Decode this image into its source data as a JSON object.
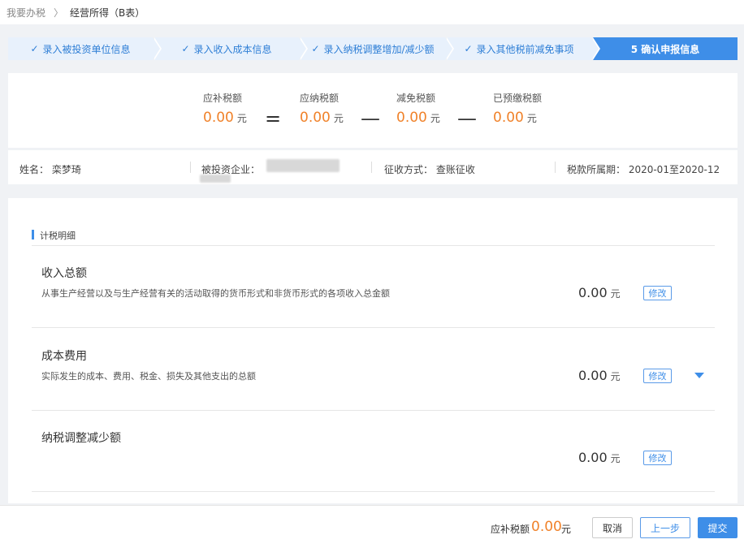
{
  "breadcrumb": {
    "home": "我要办税",
    "separator": "〉",
    "current": "经营所得（B表）"
  },
  "steps": [
    {
      "label": "录入被投资单位信息",
      "done": true
    },
    {
      "label": "录入收入成本信息",
      "done": true
    },
    {
      "label": "录入纳税调整增加/减少额",
      "done": true
    },
    {
      "label": "录入其他税前减免事项",
      "done": true
    },
    {
      "label": "5 确认申报信息",
      "done": false
    }
  ],
  "check_icon": "✓",
  "summary": {
    "items": [
      {
        "label": "应补税额",
        "value": "0.00",
        "unit": "元"
      },
      {
        "label": "应纳税额",
        "value": "0.00",
        "unit": "元"
      },
      {
        "label": "减免税额",
        "value": "0.00",
        "unit": "元"
      },
      {
        "label": "已预缴税额",
        "value": "0.00",
        "unit": "元"
      }
    ],
    "operators": [
      "=",
      "—",
      "—"
    ]
  },
  "info": {
    "name": "姓名：  栾梦琦",
    "company_label": "被投资企业：",
    "method": "征收方式：  查账征收",
    "period": "税款所属期：  2020-01至2020-12"
  },
  "detail": {
    "section_title": "计税明细",
    "rows": [
      {
        "title": "收入总额",
        "desc": "从事生产经营以及与生产经营有关的活动取得的货币形式和非货币形式的各项收入总金额",
        "amount": "0.00",
        "unit": "元",
        "edit": "修改"
      },
      {
        "title": "成本费用",
        "desc": "实际发生的成本、费用、税金、损失及其他支出的总额",
        "amount": "0.00",
        "unit": "元",
        "edit": "修改"
      },
      {
        "title": "纳税调整减少额",
        "desc": "",
        "amount": "0.00",
        "unit": "元",
        "edit": "修改"
      }
    ]
  },
  "footer": {
    "label": "应补税额",
    "value": "0.00",
    "unit": "元",
    "cancel": "取消",
    "prev": "上一步",
    "submit": "提交"
  },
  "colors": {
    "accent": "#3e8ee8",
    "amount": "#f0822a"
  }
}
